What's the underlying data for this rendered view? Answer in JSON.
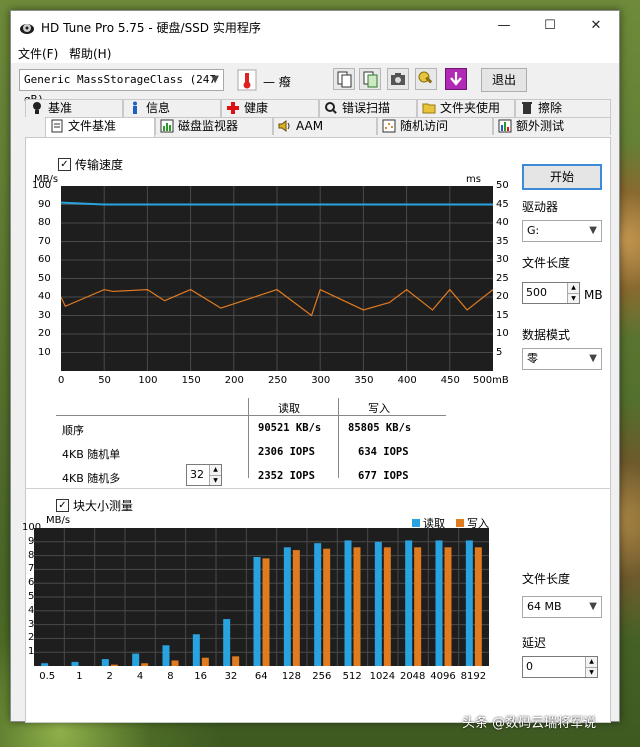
{
  "window": {
    "title": "HD Tune Pro 5.75 - 硬盘/SSD 实用程序",
    "controls": [
      "—",
      "☐",
      "✕"
    ]
  },
  "menu": [
    "文件(F)",
    "帮助(H)"
  ],
  "toolbar": {
    "drive": "Generic MassStorageClass (247 gB)",
    "temperature": "— 癈",
    "exit_label": "退出"
  },
  "tabs_row1": [
    "基准",
    "信息",
    "健康",
    "错误扫描",
    "文件夹使用",
    "擦除"
  ],
  "tabs_row2": [
    "文件基准",
    "磁盘监视器",
    "AAM",
    "随机访问",
    "额外测试"
  ],
  "active_tab": "文件基准",
  "transfer": {
    "checkbox_label": "传输速度",
    "unit_left": "MB/s",
    "unit_right": "ms",
    "y_left_ticks": [
      "100",
      "90",
      "80",
      "70",
      "60",
      "50",
      "40",
      "30",
      "20",
      "10"
    ],
    "y_right_ticks": [
      "50",
      "45",
      "40",
      "35",
      "30",
      "25",
      "20",
      "15",
      "10",
      "5"
    ],
    "x_ticks": [
      "0",
      "50",
      "100",
      "150",
      "200",
      "250",
      "300",
      "350",
      "400",
      "450",
      "500mB"
    ]
  },
  "results": {
    "col_read": "读取",
    "col_write": "写入",
    "rows": [
      {
        "label": "顺序",
        "read": "90521 KB/s",
        "write": "85805 KB/s"
      },
      {
        "label": "4KB 随机单",
        "read": "2306 IOPS",
        "write": "634 IOPS"
      },
      {
        "label": "4KB 随机多",
        "read": "2352 IOPS",
        "write": "677 IOPS"
      }
    ],
    "queue_depth": "32"
  },
  "side": {
    "start_label": "开始",
    "drive_label": "驱动器",
    "drive_value": "G:",
    "filelen_label": "文件长度",
    "filelen_value": "500",
    "filelen_unit": "MB",
    "datamode_label": "数据模式",
    "datamode_value": "零",
    "filelen2_label": "文件长度",
    "filelen2_value": "64 MB",
    "delay_label": "延迟",
    "delay_value": "0"
  },
  "blocksize": {
    "checkbox_label": "块大小测量",
    "unit": "MB/s",
    "legend_read": "读取",
    "legend_write": "写入"
  },
  "chart_data": [
    {
      "type": "line",
      "xlabel": "",
      "ylabel": "MB/s",
      "xlim": [
        0,
        500
      ],
      "ylim": [
        0,
        100
      ],
      "y2lim": [
        0,
        50
      ],
      "series": [
        {
          "name": "",
          "color": "#29a3e0",
          "x": [
            0,
            50,
            100,
            150,
            200,
            250,
            300,
            350,
            400,
            450,
            500
          ],
          "values": [
            91,
            90,
            90,
            90,
            90,
            90,
            90,
            90,
            90,
            90,
            90
          ]
        },
        {
          "name": "",
          "color": "#e07b20",
          "x": [
            0,
            5,
            50,
            60,
            100,
            120,
            150,
            185,
            250,
            290,
            300,
            350,
            380,
            400,
            430,
            450,
            470,
            500
          ],
          "values": [
            40,
            35,
            44,
            43,
            44,
            38,
            44,
            34,
            44,
            30,
            44,
            33,
            37,
            44,
            33,
            44,
            33,
            44
          ]
        }
      ]
    },
    {
      "type": "bar",
      "ylabel": "MB/s",
      "ylim": [
        0,
        100
      ],
      "categories": [
        "0.5",
        "1",
        "2",
        "4",
        "8",
        "16",
        "32",
        "64",
        "128",
        "256",
        "512",
        "1024",
        "2048",
        "4096",
        "8192"
      ],
      "series": [
        {
          "name": "读取",
          "color": "#29a3e0",
          "values": [
            2,
            3,
            5,
            9,
            15,
            23,
            34,
            79,
            86,
            89,
            91,
            90,
            91,
            91,
            91
          ]
        },
        {
          "name": "写入",
          "color": "#e07b20",
          "values": [
            0,
            0,
            1,
            2,
            4,
            6,
            7,
            78,
            84,
            85,
            86,
            86,
            86,
            86,
            86
          ]
        }
      ]
    }
  ],
  "watermark": "头条 @数码云瑞将军说"
}
